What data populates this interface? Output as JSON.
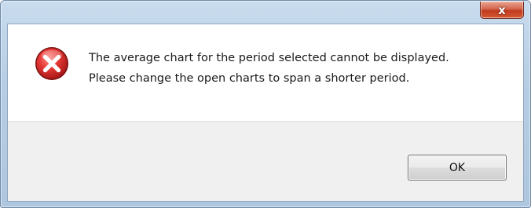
{
  "dialog": {
    "close_label": "x",
    "icon": "error-icon",
    "message_lines": [
      "The average chart for the period selected cannot be displayed.",
      "Please change the open charts to span a shorter period."
    ],
    "ok_label": "OK"
  },
  "colors": {
    "close_button": "#c94a2c",
    "error_icon": "#d32f2f",
    "footer": "#f0f0f0",
    "frame": "#b7cde3"
  }
}
